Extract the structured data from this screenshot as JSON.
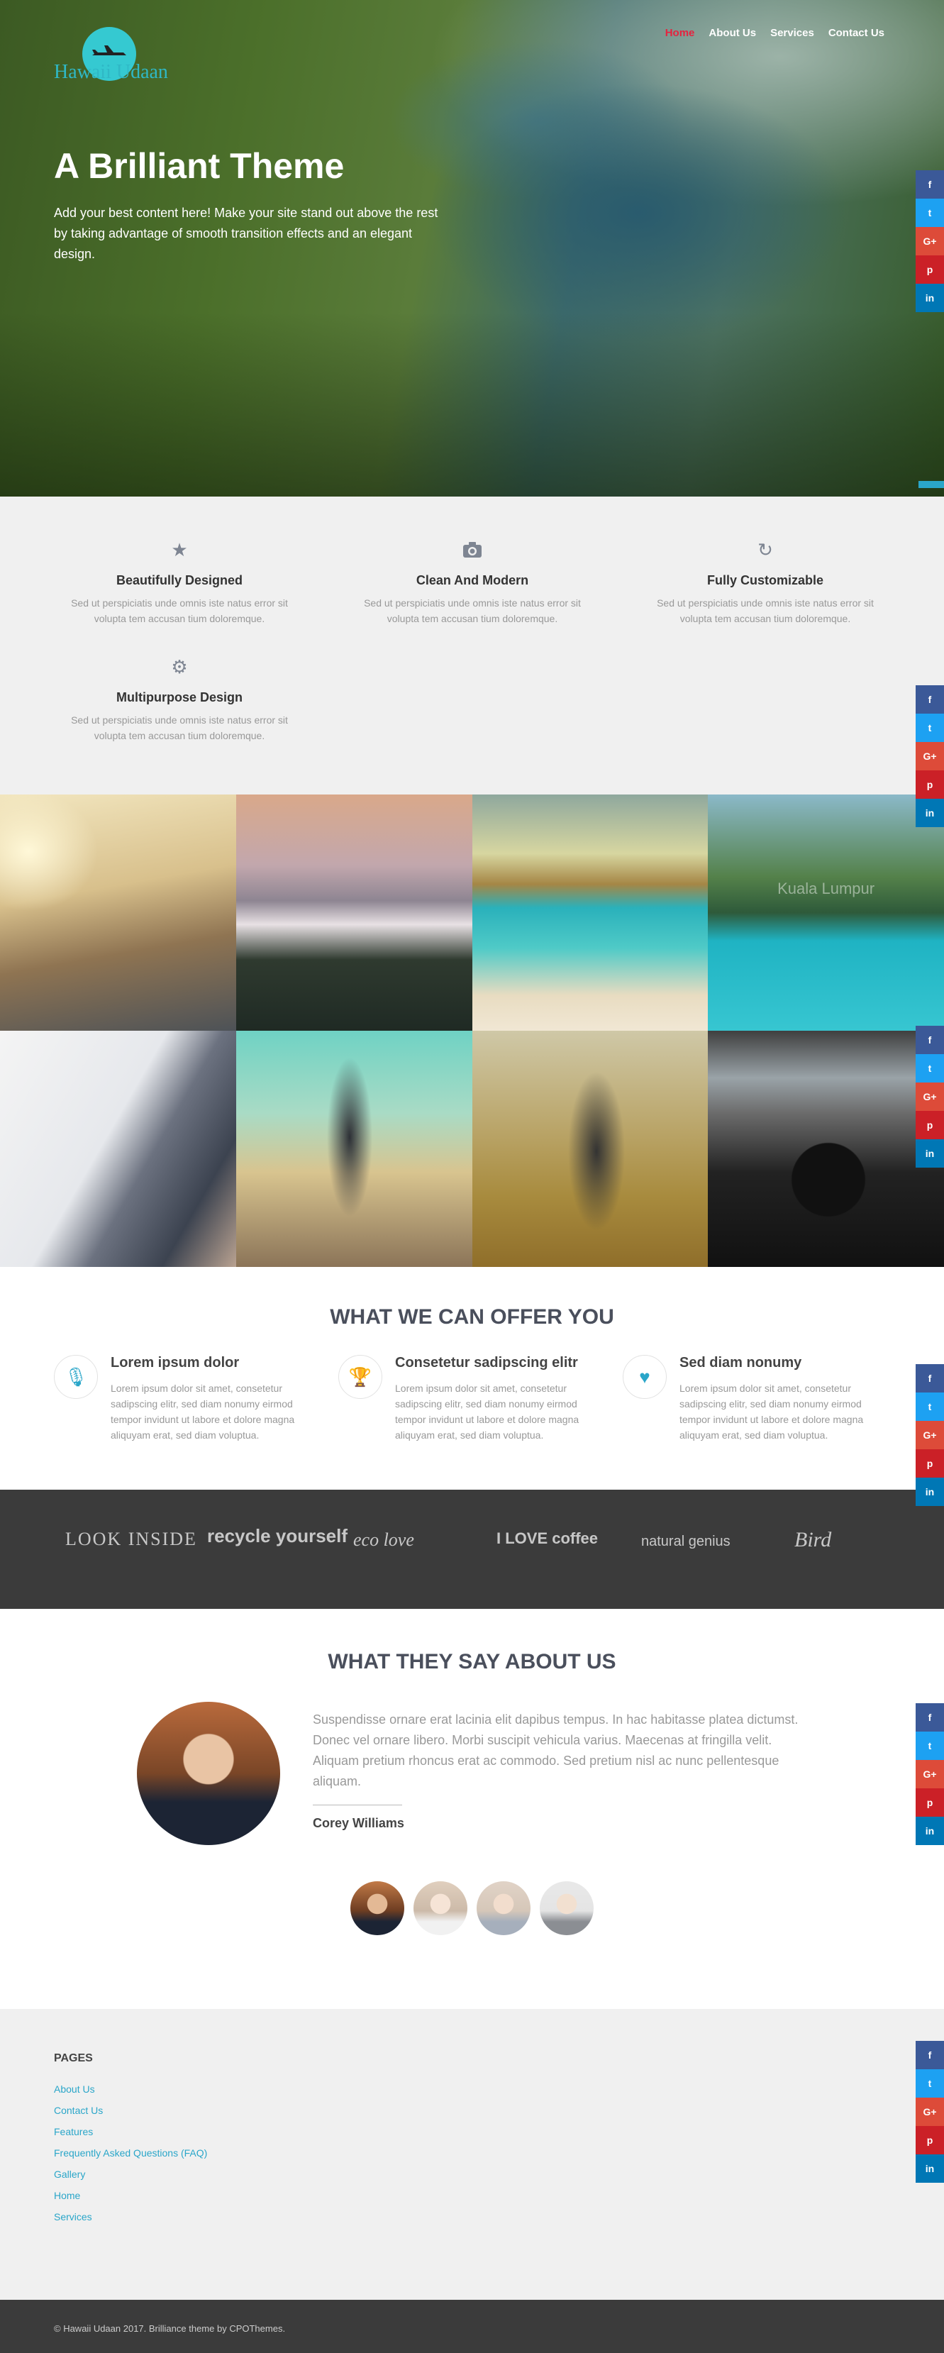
{
  "header": {
    "logo_text": "Hawaii Udaan",
    "nav": [
      {
        "label": "Home",
        "active": true
      },
      {
        "label": "About Us",
        "active": false
      },
      {
        "label": "Services",
        "active": false
      },
      {
        "label": "Contact Us",
        "active": false
      }
    ]
  },
  "hero": {
    "title": "A Brilliant Theme",
    "text": "Add your best content here! Make your site stand out above the rest by taking advantage of smooth transition effects and an elegant design."
  },
  "share_buttons": [
    {
      "icon": "facebook-icon",
      "glyph": "f",
      "color": "#3b5998"
    },
    {
      "icon": "twitter-icon",
      "glyph": "t",
      "color": "#1da1f2"
    },
    {
      "icon": "google-plus-icon",
      "glyph": "G+",
      "color": "#dd4b39"
    },
    {
      "icon": "pinterest-icon",
      "glyph": "p",
      "color": "#cb2027"
    },
    {
      "icon": "linkedin-icon",
      "glyph": "in",
      "color": "#0077b5"
    }
  ],
  "features": [
    {
      "icon": "star-icon",
      "title": "Beautifully Designed",
      "text": "Sed ut perspiciatis unde omnis iste natus error sit volupta tem accusan tium doloremque."
    },
    {
      "icon": "camera-icon",
      "title": "Clean And Modern",
      "text": "Sed ut perspiciatis unde omnis iste natus error sit volupta tem accusan tium doloremque."
    },
    {
      "icon": "refresh-icon",
      "title": "Fully Customizable",
      "text": "Sed ut perspiciatis unde omnis iste natus error sit volupta tem accusan tium doloremque."
    },
    {
      "icon": "gear-icon",
      "title": "Multipurpose Design",
      "text": "Sed ut perspiciatis unde omnis iste natus error sit volupta tem accusan tium doloremque."
    }
  ],
  "gallery": {
    "caption": "Kuala Lumpur"
  },
  "offer": {
    "title": "WHAT WE CAN OFFER YOU",
    "items": [
      {
        "icon": "microphone-icon",
        "title": "Lorem ipsum dolor",
        "text": "Lorem ipsum dolor sit amet, consetetur sadipscing elitr, sed diam nonumy eirmod tempor invidunt ut labore et dolore magna aliquyam erat, sed diam voluptua."
      },
      {
        "icon": "trophy-icon",
        "title": "Consetetur sadipscing elitr",
        "text": "Lorem ipsum dolor sit amet, consetetur sadipscing elitr, sed diam nonumy eirmod tempor invidunt ut labore et dolore magna aliquyam erat, sed diam voluptua."
      },
      {
        "icon": "heart-icon",
        "title": "Sed diam nonumy",
        "text": "Lorem ipsum dolor sit amet, consetetur sadipscing elitr, sed diam nonumy eirmod tempor invidunt ut labore et dolore magna aliquyam erat, sed diam voluptua."
      }
    ]
  },
  "brands": [
    {
      "name": "LOOK INSIDE"
    },
    {
      "name": "recycle yourself"
    },
    {
      "name": "eco love"
    },
    {
      "name": "I LOVE coffee"
    },
    {
      "name": "natural genius"
    },
    {
      "name": "Bird"
    }
  ],
  "testimonials": {
    "title": "WHAT THEY SAY ABOUT US",
    "quote": "Suspendisse ornare erat lacinia elit dapibus tempus. In hac habitasse platea dictumst. Donec vel ornare libero. Morbi suscipit vehicula varius. Maecenas at fringilla velit. Aliquam pretium rhoncus erat ac commodo. Sed pretium nisl ac nunc pellentesque aliquam.",
    "name": "Corey Williams"
  },
  "footer": {
    "pages_title": "PAGES",
    "pages": [
      "About Us",
      "Contact Us",
      "Features",
      "Frequently Asked Questions (FAQ)",
      "Gallery",
      "Home",
      "Services"
    ],
    "copyright": "© Hawaii Udaan 2017. Brilliance theme by CPOThemes."
  }
}
